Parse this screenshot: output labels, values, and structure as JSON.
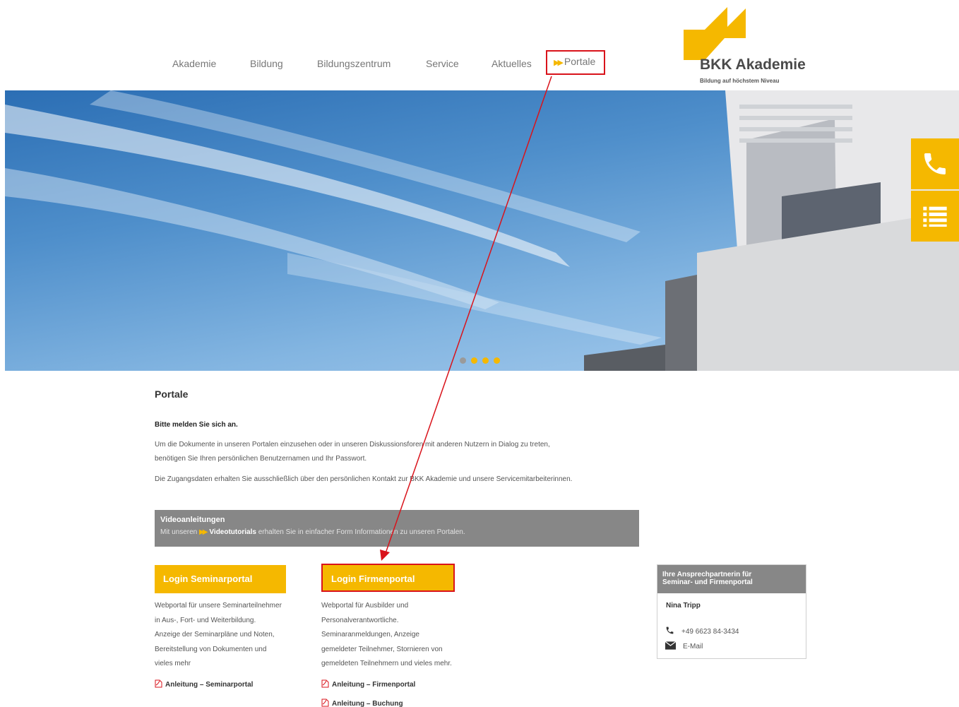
{
  "nav": {
    "items": [
      "Akademie",
      "Bildung",
      "Bildungszentrum",
      "Service",
      "Aktuelles"
    ],
    "portale_label": "Portale"
  },
  "logo": {
    "name": "BKK Akademie",
    "tagline": "Bildung auf höchstem Niveau"
  },
  "colors": {
    "accent": "#f5b800",
    "highlight": "#d9131b",
    "panel_grey": "#878787"
  },
  "hero": {
    "slides": 4,
    "active_slide": 2
  },
  "side_buttons": [
    "phone-icon",
    "list-icon"
  ],
  "content": {
    "title": "Portale",
    "subtitle": "Bitte melden Sie sich an.",
    "para1_line1": "Um die Dokumente in unseren Portalen einzusehen oder in unseren Diskussionsforen mit anderen Nutzern in Dialog zu treten,",
    "para1_line2": "benötigen Sie Ihren persönlichen Benutzernamen und Ihr Passwort.",
    "para2": "Die Zugangsdaten erhalten Sie ausschließlich über den persönlichen Kontakt zur BKK Akademie und unsere Servicemitarbeiterinnen."
  },
  "video": {
    "title": "Videoanleitungen",
    "text_before": "Mit unseren",
    "link": "Videotutorials",
    "text_after": "erhalten Sie in einfacher Form Informationen zu unseren Portalen."
  },
  "seminar": {
    "login_label": "Login Seminarportal",
    "desc_lines": [
      "Webportal für unsere Seminarteilnehmer",
      "in Aus-, Fort- und Weiterbildung.",
      "Anzeige der Seminarpläne und Noten,",
      "Bereitstellung von Dokumenten und",
      "vieles mehr"
    ],
    "guide": "Anleitung – Seminarportal"
  },
  "firm": {
    "login_label": "Login Firmenportal",
    "desc_lines": [
      "Webportal für Ausbilder und",
      "Personalverantwortliche.",
      "Seminaranmeldungen, Anzeige",
      "gemeldeter Teilnehmer, Stornieren von",
      "gemeldeten Teilnehmern und vieles mehr."
    ],
    "guide1": "Anleitung – Firmenportal",
    "guide2": "Anleitung – Buchung"
  },
  "contact": {
    "heading_line1": "Ihre Ansprechpartnerin für",
    "heading_line2": "Seminar- und Firmenportal",
    "name": "Nina Tripp",
    "phone": "+49 6623 84-3434",
    "email_label": "E-Mail"
  }
}
